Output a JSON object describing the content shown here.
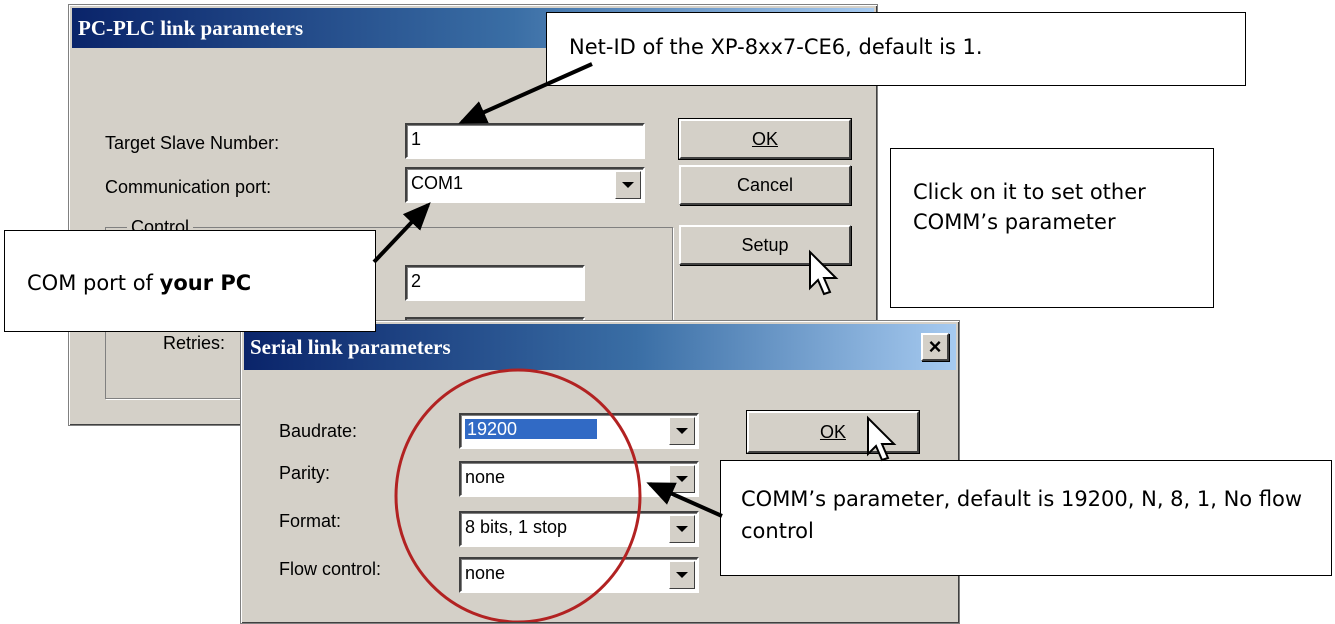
{
  "plc_dialog": {
    "title": "PC-PLC link parameters",
    "target_slave_label": "Target Slave Number:",
    "target_slave_value": "1",
    "comm_port_label": "Communication port:",
    "comm_port_value": "COM1",
    "control_group_label": "Control",
    "control_value_1": "2",
    "retries_label": "Retries:",
    "ok_label": "OK",
    "cancel_label": "Cancel",
    "setup_label": "Setup"
  },
  "serial_dialog": {
    "title": "Serial link parameters",
    "close_glyph": "×",
    "baudrate_label": "Baudrate:",
    "baudrate_value": "19200",
    "parity_label": "Parity:",
    "parity_value": "none",
    "format_label": "Format:",
    "format_value": "8 bits, 1 stop",
    "flow_label": "Flow control:",
    "flow_value": "none",
    "ok_label": "OK"
  },
  "callouts": {
    "net_id": "Net-ID of the XP-8xx7-CE6, default is 1.",
    "com_port_prefix": "COM port of ",
    "com_port_bold": "your PC",
    "setup_note": "Click on it to set other COMM’s parameter",
    "comm_params": "COMM’s parameter, default is 19200, N, 8, 1, No flow control"
  },
  "colors": {
    "titlebar_start": "#0a246a",
    "highlight_circle": "#b22222",
    "selection": "#316ac5"
  }
}
